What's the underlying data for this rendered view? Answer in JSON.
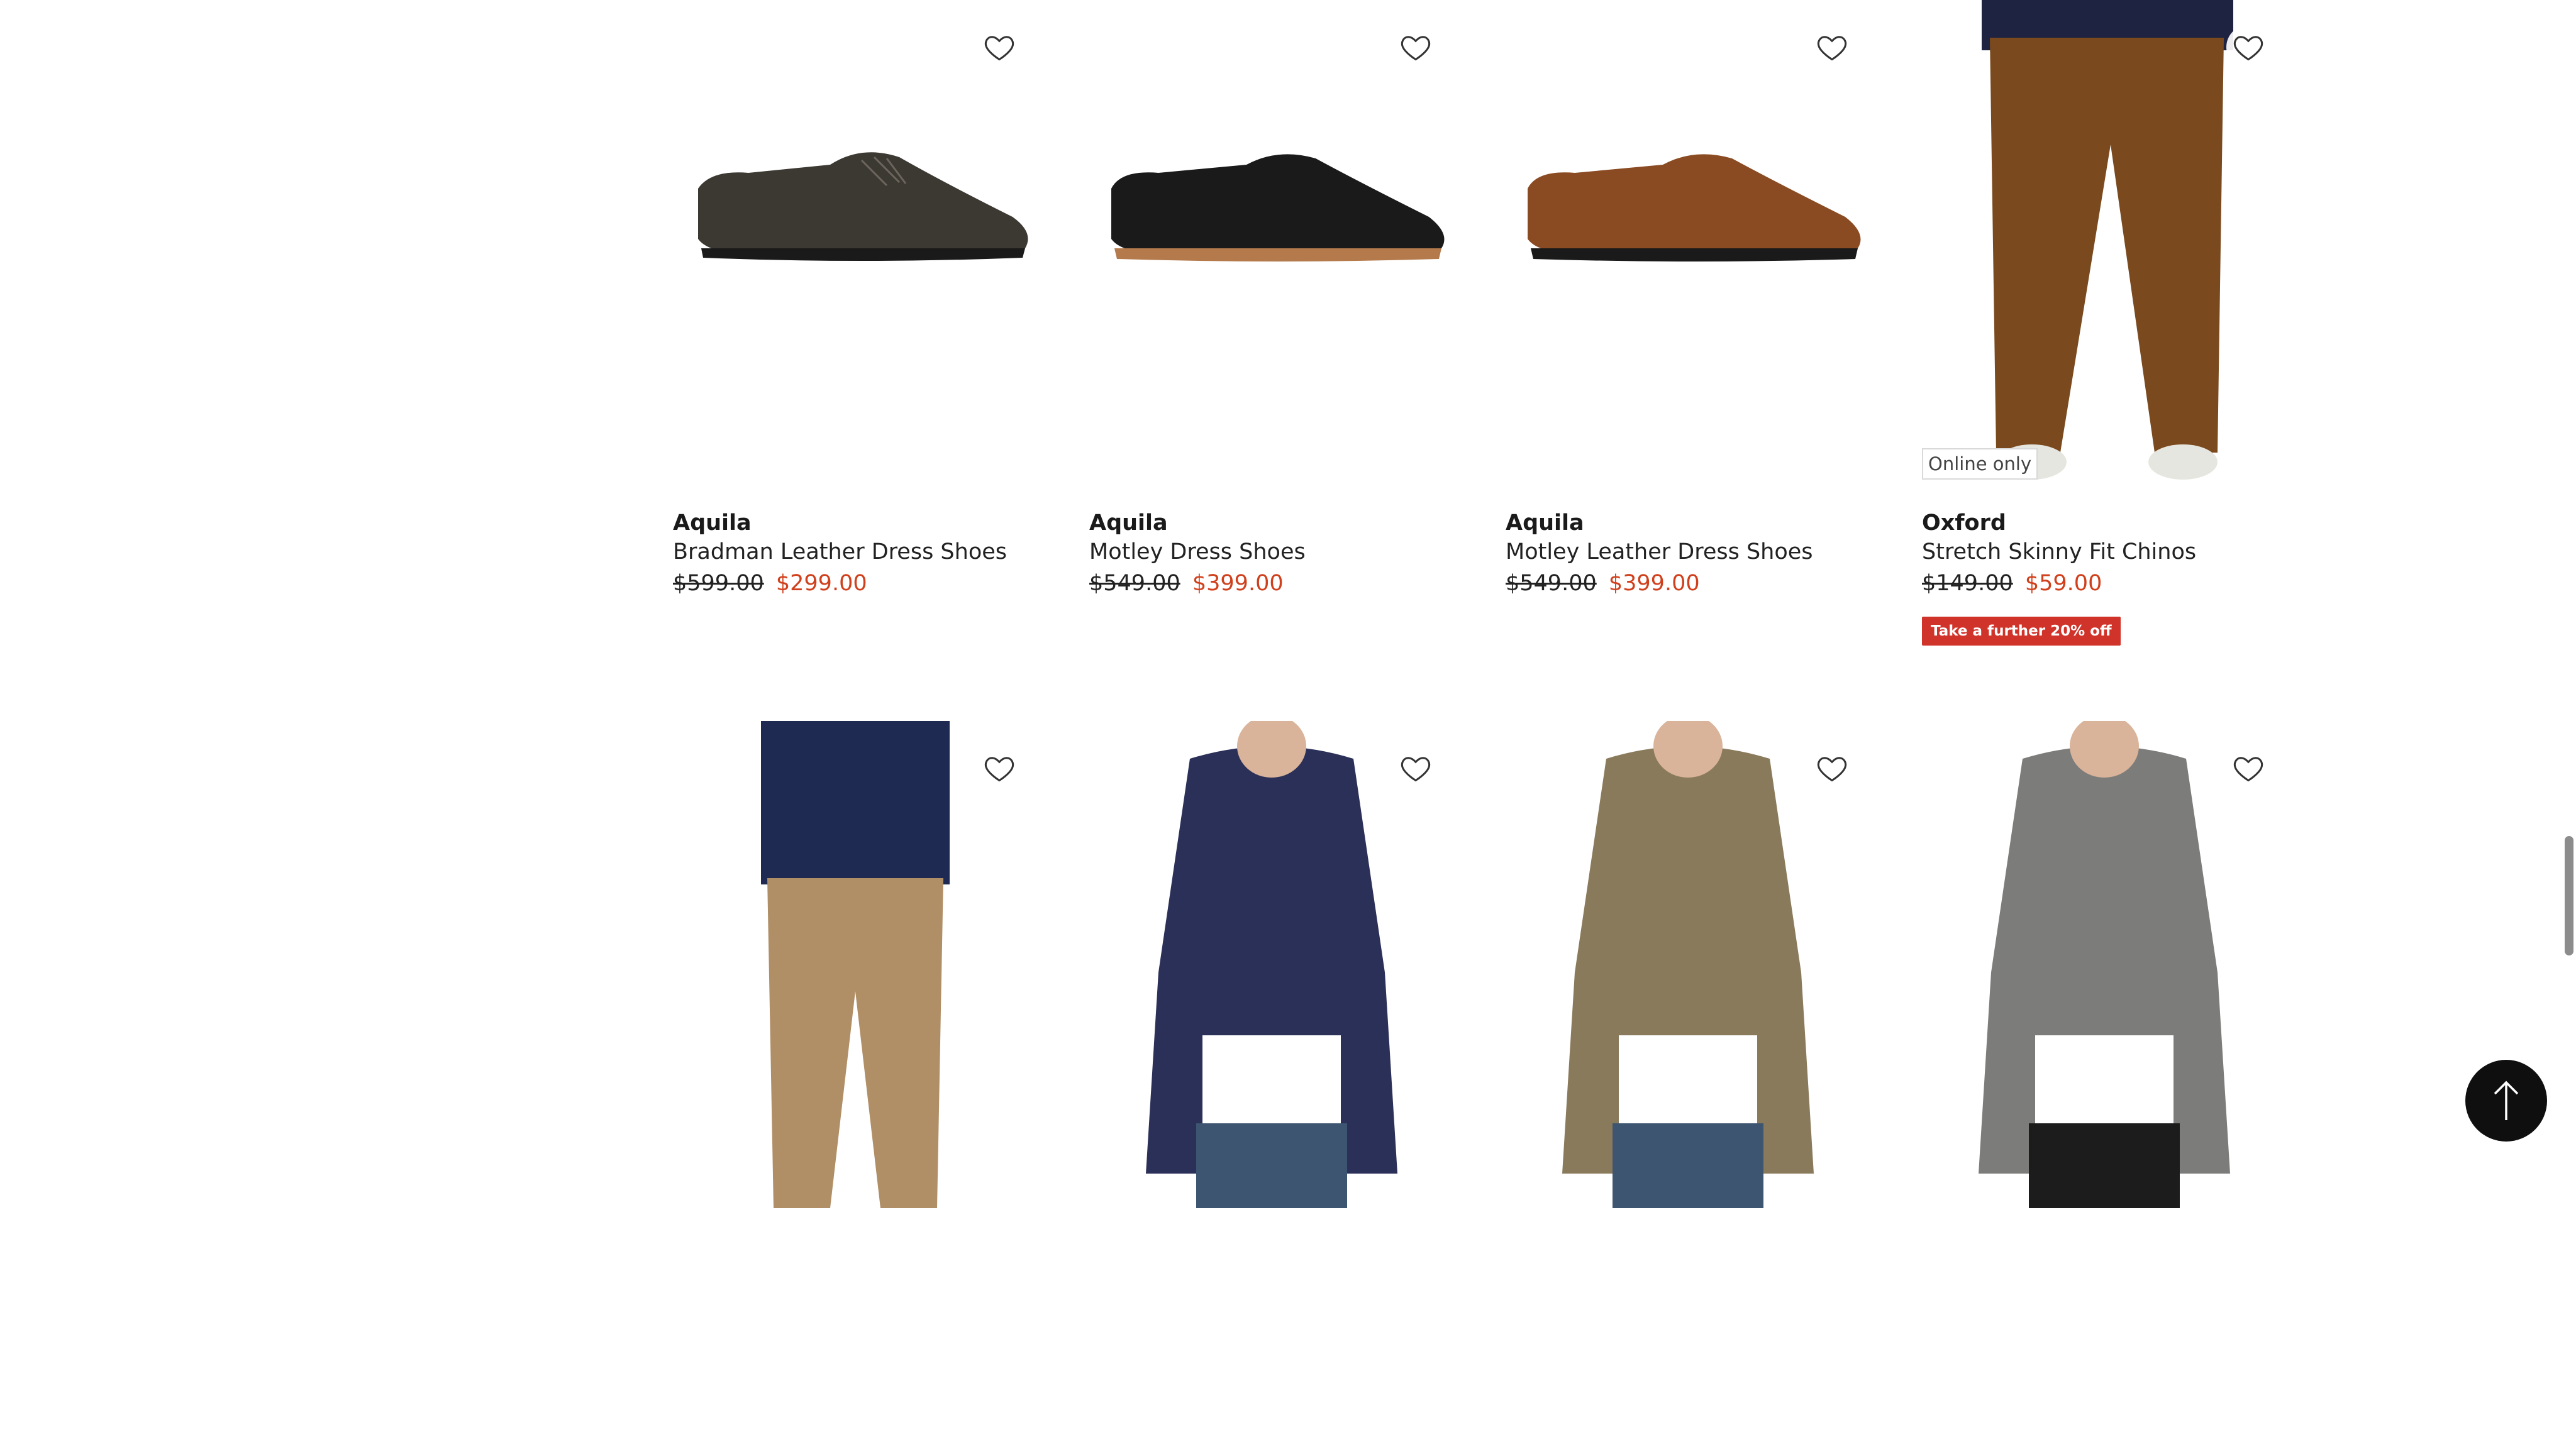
{
  "products": [
    {
      "brand": "Aquila",
      "name": "Bradman Leather Dress Shoes",
      "was": "$599.00",
      "now": "$299.00",
      "kind": "shoe",
      "color": "#3c3832"
    },
    {
      "brand": "Aquila",
      "name": "Motley Dress Shoes",
      "was": "$549.00",
      "now": "$399.00",
      "kind": "shoe",
      "color": "#1a1a1a"
    },
    {
      "brand": "Aquila",
      "name": "Motley Leather Dress Shoes",
      "was": "$549.00",
      "now": "$399.00",
      "kind": "shoe",
      "color": "#8a4a22"
    },
    {
      "brand": "Oxford",
      "name": "Stretch Skinny Fit Chinos",
      "was": "$149.00",
      "now": "$59.00",
      "kind": "chinos",
      "color": "#7a4a1e",
      "badge": "Online only",
      "promo": "Take a further 20% off"
    },
    {
      "kind": "chinos-beige",
      "color": "#b08e66"
    },
    {
      "kind": "tee",
      "color": "#2b3058"
    },
    {
      "kind": "tee",
      "color": "#8a7a5c"
    },
    {
      "kind": "tee",
      "color": "#7c7c7a"
    }
  ],
  "icons": {
    "favourite": "heart-outline-icon",
    "scroll_top": "arrow-up-icon"
  },
  "colors": {
    "sale_price": "#d0401c",
    "promo_bg": "#d0332a"
  }
}
